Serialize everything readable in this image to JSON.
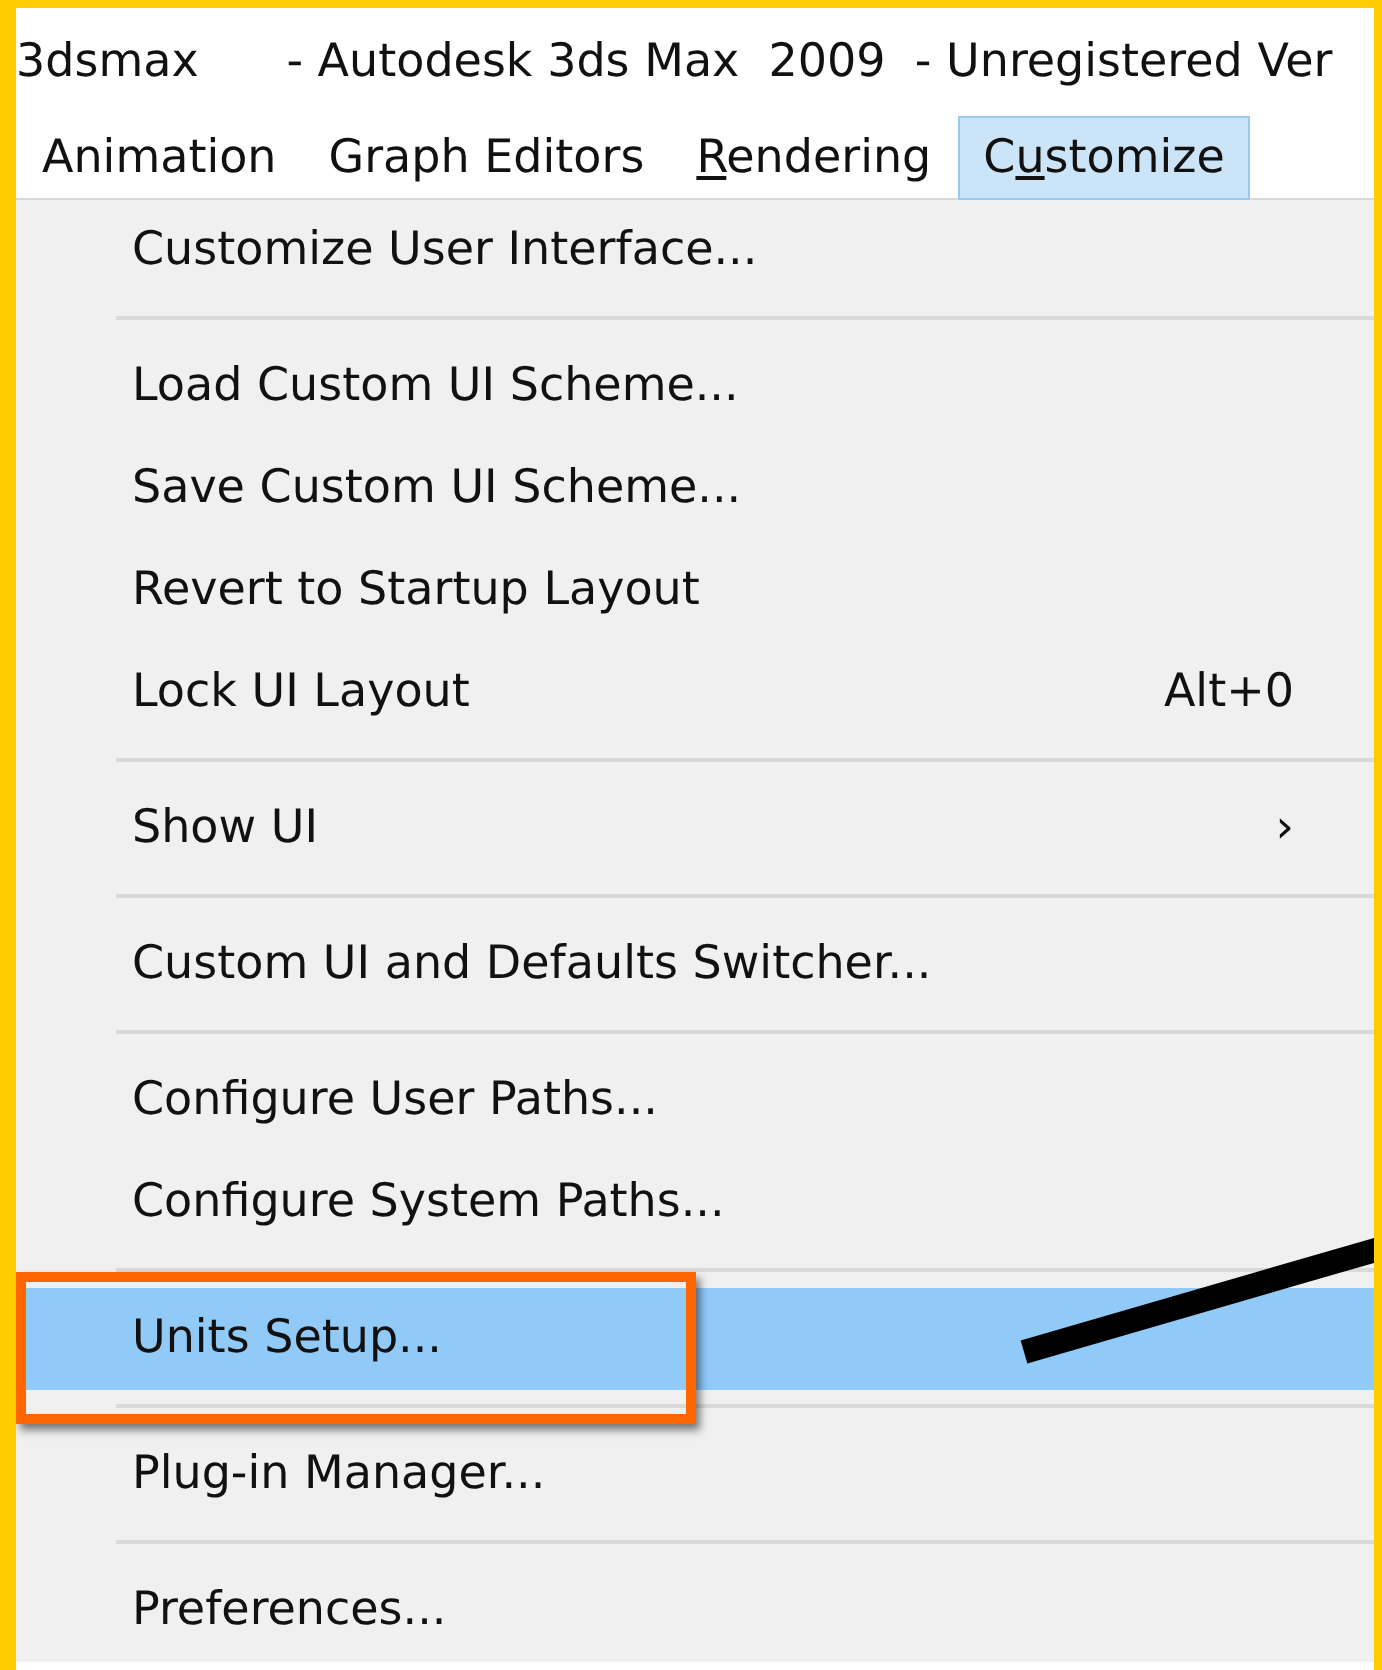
{
  "window": {
    "title": "3dsmax      - Autodesk 3ds Max  2009  - Unregistered Ver"
  },
  "menubar": [
    {
      "pre": "Animation",
      "selected": false
    },
    {
      "pre": "Graph Editors",
      "selected": false
    },
    {
      "key": "R",
      "post": "endering",
      "selected": false
    },
    {
      "pre": "C",
      "key": "u",
      "post": "stomize",
      "selected": true
    }
  ],
  "menu": [
    {
      "kind": "item",
      "label": "Customize User Interface...",
      "selected": false
    },
    {
      "kind": "separator"
    },
    {
      "kind": "item",
      "label": "Load Custom UI Scheme...",
      "selected": false
    },
    {
      "kind": "item",
      "label": "Save Custom UI Scheme...",
      "selected": false
    },
    {
      "kind": "item",
      "label": "Revert to Startup Layout",
      "selected": false
    },
    {
      "kind": "item",
      "label": "Lock UI Layout",
      "shortcut": "Alt+0",
      "selected": false
    },
    {
      "kind": "separator"
    },
    {
      "kind": "item",
      "label": "Show UI",
      "submenu": "›",
      "selected": false
    },
    {
      "kind": "separator"
    },
    {
      "kind": "item",
      "label": "Custom UI and Defaults Switcher...",
      "selected": false
    },
    {
      "kind": "separator"
    },
    {
      "kind": "item",
      "label": "Configure User Paths...",
      "selected": false
    },
    {
      "kind": "item",
      "label": "Configure System Paths...",
      "selected": false
    },
    {
      "kind": "separator"
    },
    {
      "kind": "item",
      "label": "Units Setup...",
      "selected": true,
      "highlighted": true
    },
    {
      "kind": "separator"
    },
    {
      "kind": "item",
      "label": "Plug-in Manager...",
      "selected": false
    },
    {
      "kind": "separator"
    },
    {
      "kind": "item",
      "label": "Preferences...",
      "selected": false
    }
  ]
}
